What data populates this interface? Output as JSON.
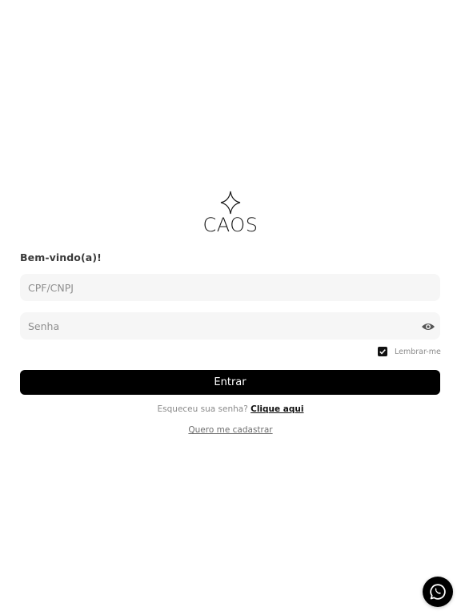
{
  "brand": {
    "name": "CAOS",
    "logo_icon": "four-point-star-icon"
  },
  "login": {
    "welcome_text": "Bem-vindo(a)!",
    "user_field": {
      "placeholder": "CPF/CNPJ",
      "value": ""
    },
    "password_field": {
      "placeholder": "Senha",
      "value": "",
      "toggle_icon": "eye-icon"
    },
    "remember_me": {
      "label": "Lembrar-me",
      "checked": true
    },
    "submit_label": "Entrar",
    "forgot_text": "Esqueceu sua senha?",
    "forgot_link": "Clique aqui",
    "register_link": "Quero me cadastrar"
  },
  "floating": {
    "chat_icon": "whatsapp-icon"
  },
  "colors": {
    "background": "#ffffff",
    "primary": "#000000",
    "input_bg": "#f6f6f6",
    "muted_text": "#8a8a8a"
  }
}
